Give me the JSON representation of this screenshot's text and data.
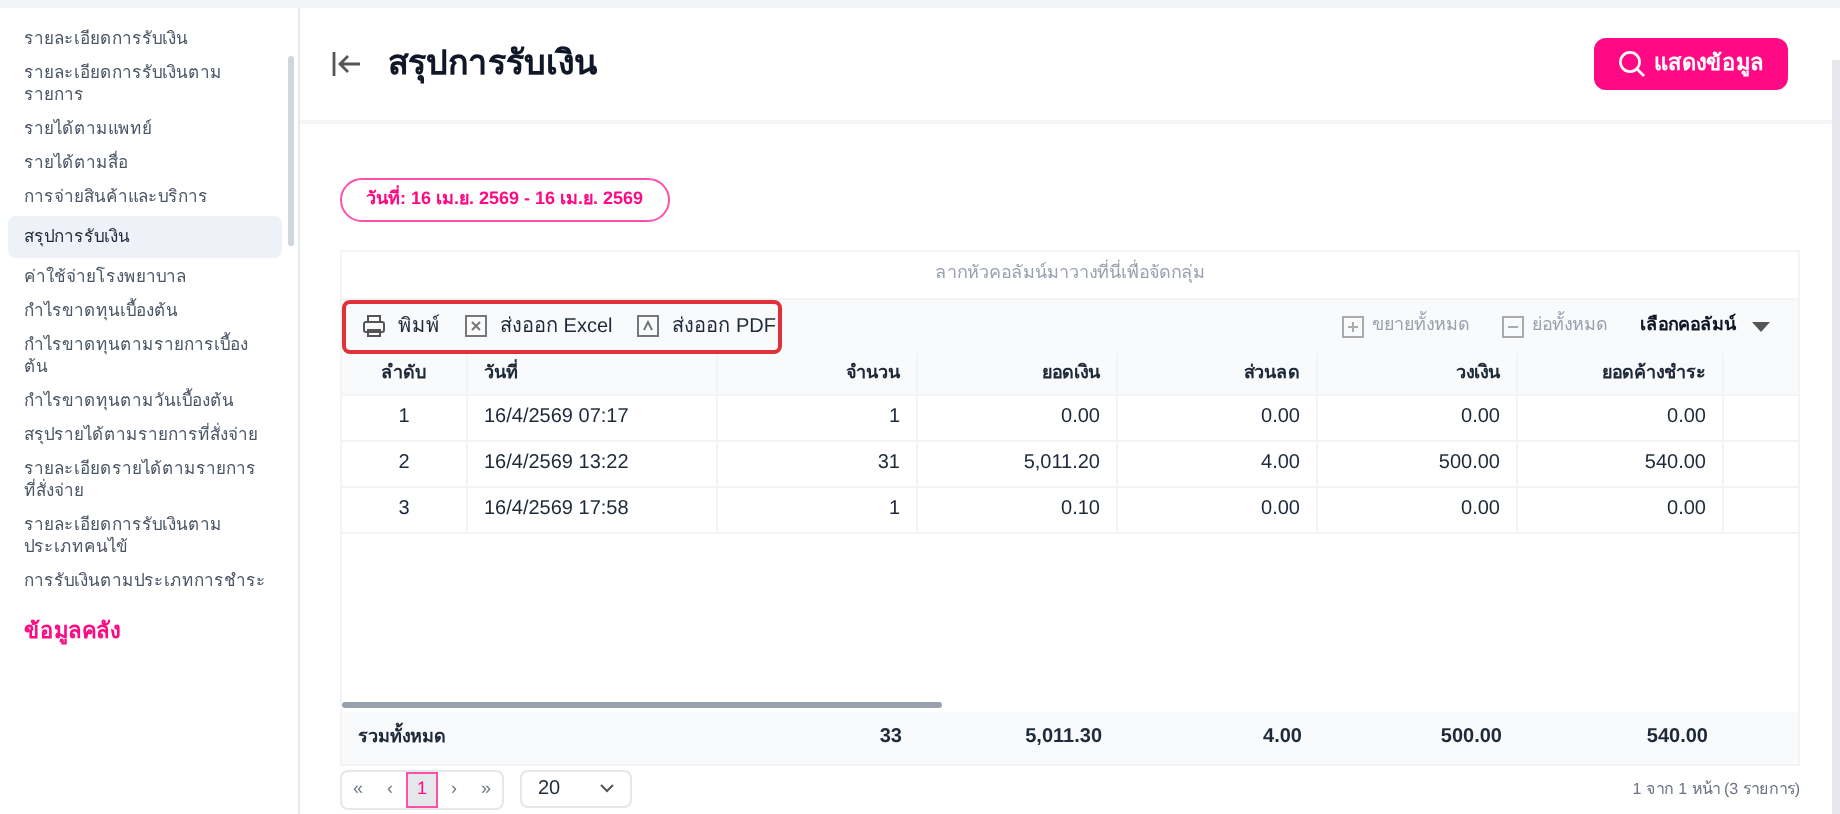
{
  "sidebar": {
    "items": [
      {
        "label": "รายละเอียดการรับเงิน",
        "selected": false
      },
      {
        "label": "รายละเอียดการรับเงินตามรายการ",
        "selected": false
      },
      {
        "label": "รายได้ตามแพทย์",
        "selected": false
      },
      {
        "label": "รายได้ตามสื่อ",
        "selected": false
      },
      {
        "label": "การจ่ายสินค้าและบริการ",
        "selected": false
      },
      {
        "label": "สรุปการรับเงิน",
        "selected": true
      },
      {
        "label": "ค่าใช้จ่ายโรงพยาบาล",
        "selected": false
      },
      {
        "label": "กำไรขาดทุนเบื้องต้น",
        "selected": false
      },
      {
        "label": "กำไรขาดทุนตามรายการเบื้องต้น",
        "selected": false
      },
      {
        "label": "กำไรขาดทุนตามวันเบื้องต้น",
        "selected": false
      },
      {
        "label": "สรุปรายได้ตามรายการที่สั่งจ่าย",
        "selected": false
      },
      {
        "label": "รายละเอียดรายได้ตามรายการที่สั่งจ่าย",
        "selected": false
      },
      {
        "label": "รายละเอียดการรับเงินตามประเภทคนไข้",
        "selected": false
      },
      {
        "label": "การรับเงินตามประเภทการชำระ",
        "selected": false
      }
    ],
    "section_heading": "ข้อมูลคลัง"
  },
  "page_title": "สรุปการรับเงิน",
  "show_button": "แสดงข้อมูล",
  "date_filter": "วันที่: 16 เม.ย. 2569 - 16 เม.ย. 2569",
  "group_hint": "ลากหัวคอลัมน์มาวางที่นี่เพื่อจัดกลุ่ม",
  "toolbar": {
    "left": [
      "พิมพ์",
      "ส่งออก Excel",
      "ส่งออก PDF"
    ],
    "expand_all": "ขยายทั้งหมด",
    "collapse_all": "ย่อทั้งหมด",
    "choose_columns": "เลือกคอลัมน์"
  },
  "table": {
    "columns": [
      "ลำดับ",
      "วันที่",
      "จำนวน",
      "ยอดเงิน",
      "ส่วนลด",
      "วงเงิน",
      "ยอดค้างชำระ"
    ],
    "rows": [
      [
        "1",
        "16/4/2569 07:17",
        "1",
        "0.00",
        "0.00",
        "0.00",
        "0.00"
      ],
      [
        "2",
        "16/4/2569 13:22",
        "31",
        "5,011.20",
        "4.00",
        "500.00",
        "540.00"
      ],
      [
        "3",
        "16/4/2569 17:58",
        "1",
        "0.10",
        "0.00",
        "0.00",
        "0.00"
      ]
    ],
    "totals": [
      "รวมทั้งหมด",
      "33",
      "5,011.30",
      "4.00",
      "500.00",
      "540.00"
    ]
  },
  "pagination": {
    "first": "«",
    "prev": "‹",
    "pages": [
      {
        "label": "1",
        "selected": true
      }
    ],
    "next": "›",
    "last": "»",
    "page_size": "20",
    "summary": "1 จาก 1 หน้า (3 รายการ)"
  }
}
